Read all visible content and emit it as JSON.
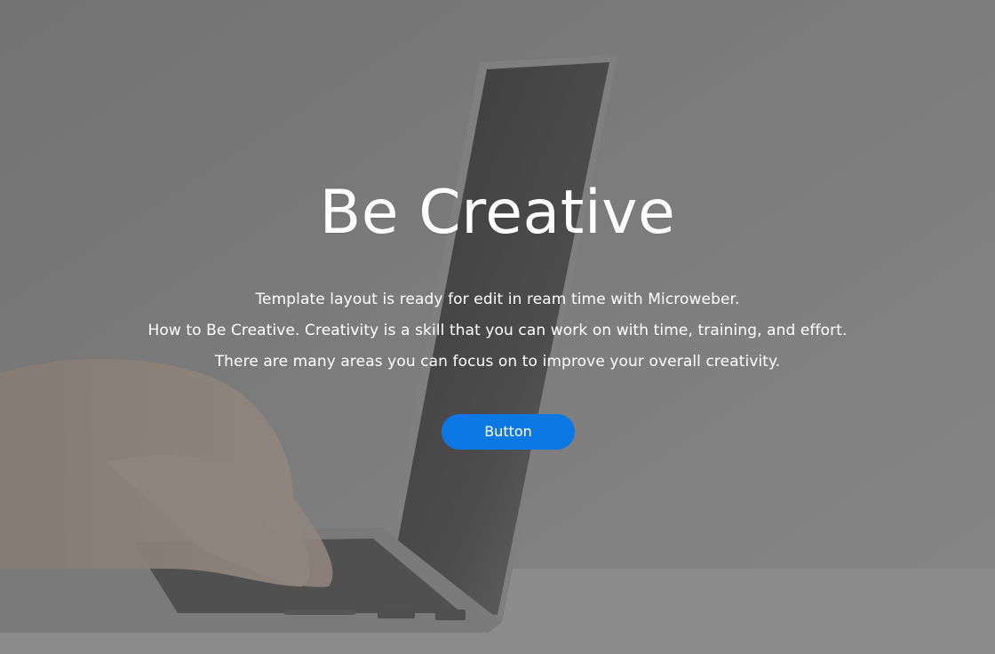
{
  "hero": {
    "title": "Be Creative",
    "description_lines": [
      "Template layout is ready for edit in ream time with Microweber.",
      "How to Be Creative. Creativity is a skill that you can work on with time, training, and effort.",
      "There are many areas you can focus on to improve your overall creativity."
    ],
    "button_label": "Button"
  },
  "colors": {
    "button": "#0b78e3",
    "text": "#ffffff"
  }
}
